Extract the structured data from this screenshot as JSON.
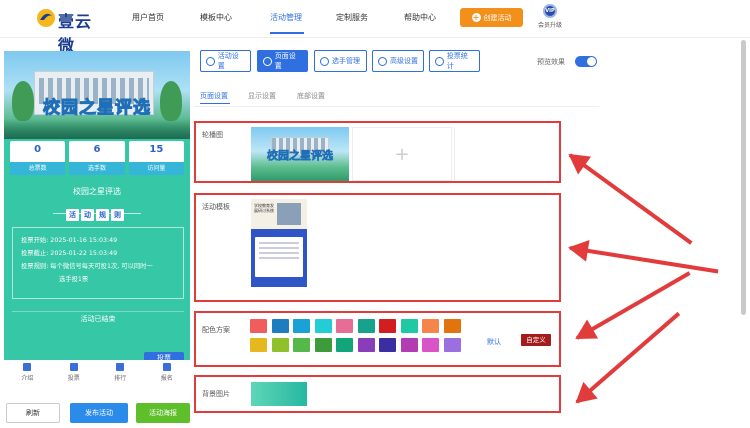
{
  "header": {
    "brand": "壹云微",
    "nav": [
      "用户首页",
      "模板中心",
      "活动管理",
      "定制服务",
      "帮助中心"
    ],
    "create_button": "创建活动",
    "vip_badge": "VIP",
    "vip_label": "会员升级"
  },
  "preview": {
    "banner_title": "校园之星评选",
    "stats": [
      {
        "value": "0",
        "label": "总票数"
      },
      {
        "value": "6",
        "label": "选手数"
      },
      {
        "value": "15",
        "label": "访问量"
      }
    ],
    "campaign_name": "校园之星评选",
    "rules_chars": [
      "活",
      "动",
      "规",
      "则"
    ],
    "info": {
      "start": "投票开始: 2025-01-16 15:03:49",
      "end": "投票截止: 2025-01-22 15:03:49",
      "rule_line1": "投票规则: 每个微信号每天可投1次, 可以同时一",
      "rule_line2": "选手投1票"
    },
    "ended_text": "活动已结束",
    "vote_button": "投票",
    "tabs": [
      "介绍",
      "投票",
      "排行",
      "报名"
    ]
  },
  "actions": {
    "refresh": "刷新",
    "publish": "发布活动",
    "poster": "活动海报"
  },
  "settings": {
    "toolbar": [
      "活动设置",
      "页面设置",
      "选手管理",
      "高级设置",
      "投票统计"
    ],
    "preview_effect": "预览效果",
    "subtabs": [
      "页面设置",
      "显示设置",
      "底部设置"
    ],
    "carousel_label": "轮播图",
    "carousel_image_title": "校园之星评选",
    "template_label": "活动模板",
    "template_caption": "学校教育发展研讨系统",
    "scheme_label": "配色方案",
    "swatch_colors": [
      "#f15c5c",
      "#1d7dbf",
      "#1aa2d8",
      "#23cdd6",
      "#e66e96",
      "#16a28c",
      "#d21e1e",
      "#1fc9a4",
      "#f5854a",
      "#e0740f",
      "#e6b81f",
      "#8ec12c",
      "#55b84a",
      "#3d9b3b",
      "#13a57a",
      "#8a3db8",
      "#3a2ea0",
      "#b23cb2",
      "#d954c9",
      "#9b6fe0"
    ],
    "default_label": "默认",
    "custom_button": "自定义",
    "background_label": "背景图片"
  }
}
